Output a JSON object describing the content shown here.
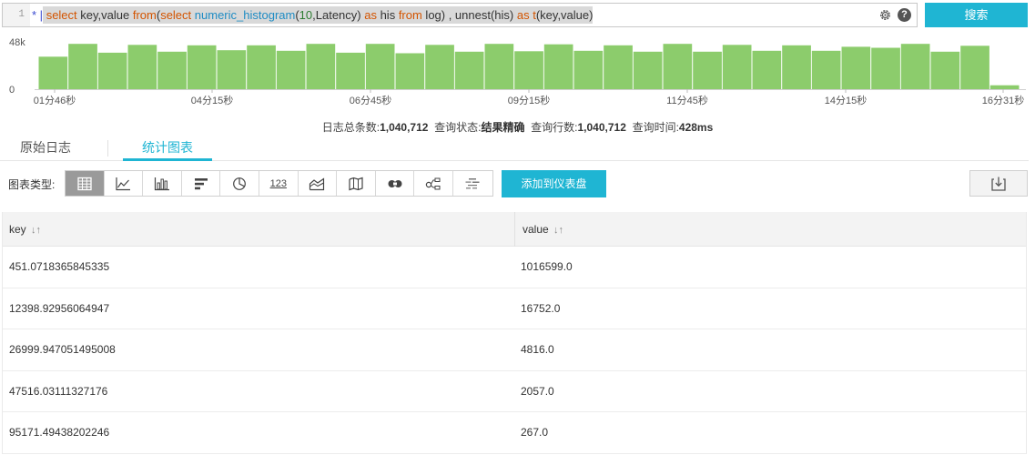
{
  "query": {
    "line_number": "1",
    "tokens": [
      {
        "text": "* |",
        "type": "star"
      },
      {
        "text": " ",
        "type": "plain"
      },
      {
        "text": "select",
        "type": "kw"
      },
      {
        "text": " key,value ",
        "type": "plain"
      },
      {
        "text": "from",
        "type": "kw"
      },
      {
        "text": "(",
        "type": "plain"
      },
      {
        "text": "select",
        "type": "kw"
      },
      {
        "text": " ",
        "type": "plain"
      },
      {
        "text": "numeric_histogram",
        "type": "fn"
      },
      {
        "text": "(",
        "type": "plain"
      },
      {
        "text": "10",
        "type": "num"
      },
      {
        "text": ",Latency) ",
        "type": "plain"
      },
      {
        "text": "as",
        "type": "kw"
      },
      {
        "text": " his ",
        "type": "plain"
      },
      {
        "text": "from",
        "type": "kw"
      },
      {
        "text": " log) , unnest(his) ",
        "type": "plain"
      },
      {
        "text": "as",
        "type": "kw"
      },
      {
        "text": " ",
        "type": "plain"
      },
      {
        "text": "t",
        "type": "kw"
      },
      {
        "text": "(key,value)",
        "type": "plain"
      }
    ],
    "settings_icon": "gear-icon",
    "help_label": "?",
    "search_label": "搜索"
  },
  "chart_data": {
    "type": "bar",
    "y_ticks": [
      "48k",
      "0"
    ],
    "ylim": [
      0,
      48000
    ],
    "x_tick_labels": [
      "01分46秒",
      "04分15秒",
      "06分45秒",
      "09分15秒",
      "11分45秒",
      "14分15秒",
      "16分31秒"
    ],
    "values": [
      33000,
      46000,
      37000,
      45000,
      38000,
      44500,
      39500,
      44500,
      39000,
      46000,
      37000,
      46000,
      36500,
      45000,
      38000,
      46000,
      38500,
      45500,
      39000,
      44500,
      38000,
      46000,
      38000,
      45000,
      39000,
      44500,
      39000,
      43000,
      42000,
      46000,
      38000,
      44000,
      4000
    ],
    "bar_color": "#8ccc6c",
    "grid": false
  },
  "summary": {
    "total_label": "日志总条数:",
    "total_value": "1,040,712",
    "status_label": "查询状态:",
    "status_value": "结果精确",
    "rows_label": "查询行数:",
    "rows_value": "1,040,712",
    "time_label": "查询时间:",
    "time_value": "428ms"
  },
  "tabs": [
    {
      "label": "原始日志",
      "active": false
    },
    {
      "label": "统计图表",
      "active": true
    }
  ],
  "chart_type": {
    "label": "图表类型:",
    "types": [
      "table-icon",
      "line-chart-icon",
      "bar-chart-icon",
      "horizontal-bar-icon",
      "pie-chart-icon",
      "number-icon",
      "area-chart-icon",
      "map-icon",
      "flow-icon",
      "topology-icon",
      "word-cloud-icon"
    ],
    "number_text": "123",
    "add_dashboard_label": "添加到仪表盘",
    "download_icon": "download-icon"
  },
  "table": {
    "columns": [
      "key",
      "value"
    ],
    "sort_glyph": "↓↑",
    "rows": [
      [
        "451.0718365845335",
        "1016599.0"
      ],
      [
        "12398.92956064947",
        "16752.0"
      ],
      [
        "26999.947051495008",
        "4816.0"
      ],
      [
        "47516.03111327176",
        "2057.0"
      ],
      [
        "95171.49438202246",
        "267.0"
      ]
    ]
  }
}
